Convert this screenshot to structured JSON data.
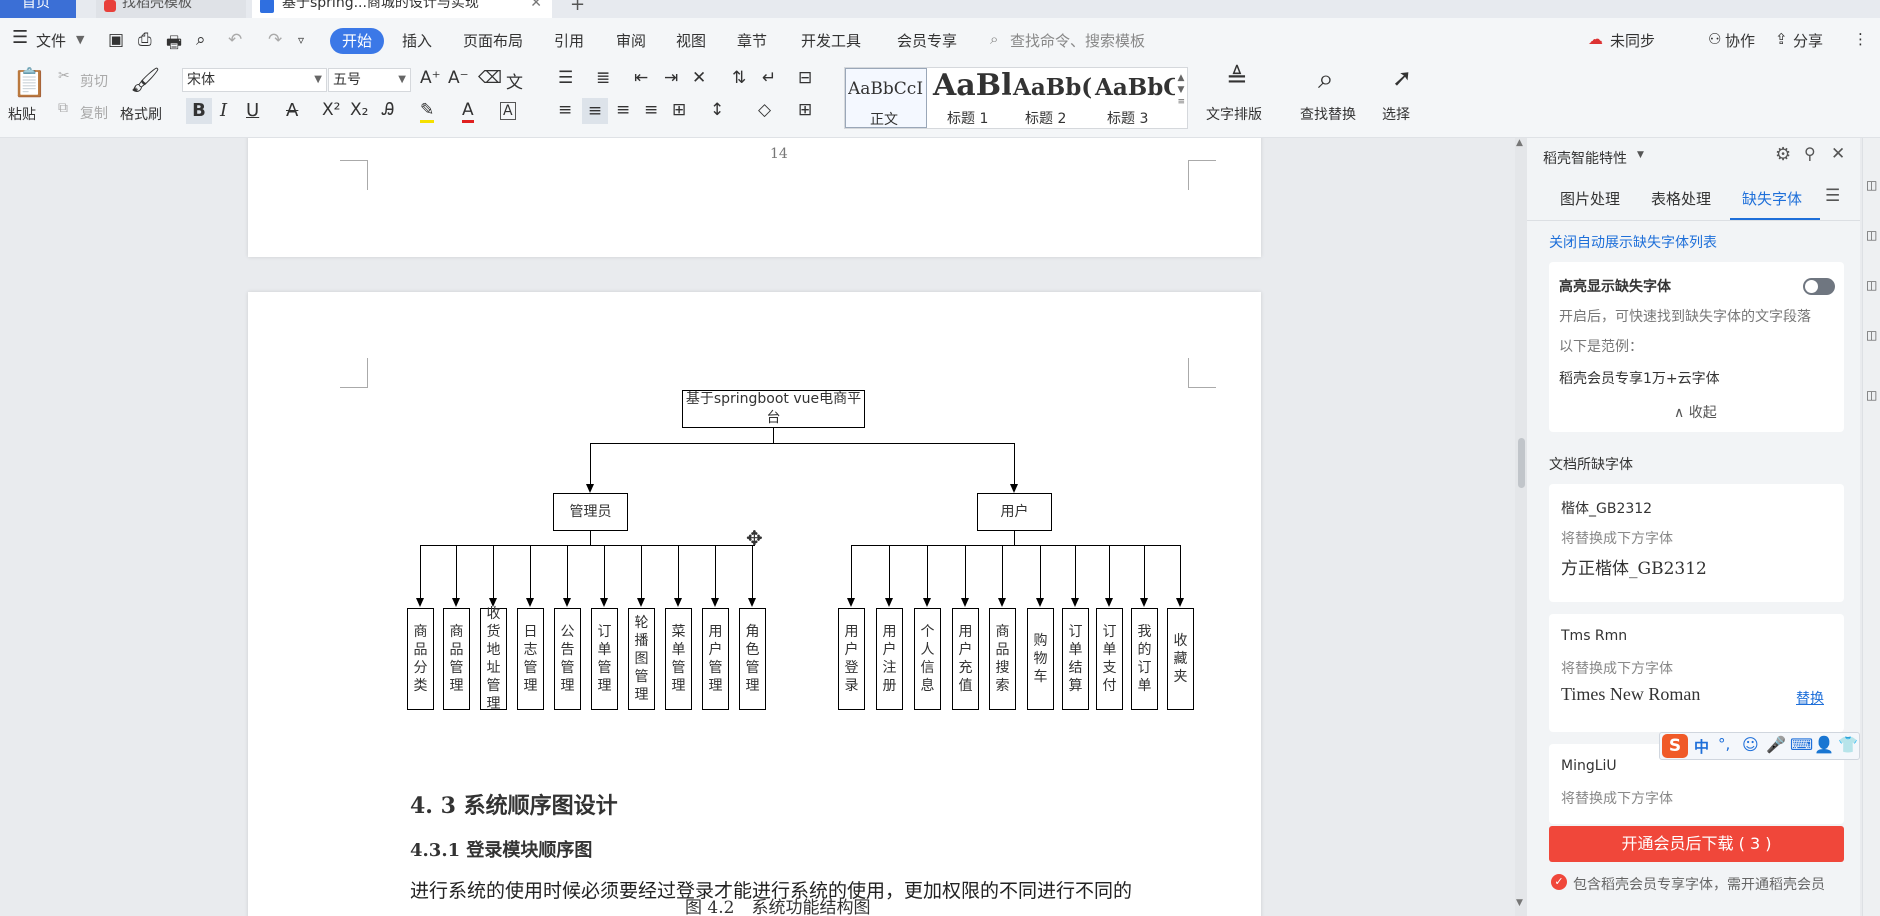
{
  "tabs": [
    {
      "label": "首页"
    },
    {
      "label": "找稻壳模板"
    },
    {
      "label": "基于spring...商城的设计与实现"
    }
  ],
  "menu": {
    "file": "文件",
    "items": [
      "开始",
      "插入",
      "页面布局",
      "引用",
      "审阅",
      "视图",
      "章节",
      "开发工具",
      "会员专享"
    ],
    "search_placeholder": "查找命令、搜索模板",
    "right": {
      "sync": "未同步",
      "collab": "协作",
      "share": "分享"
    }
  },
  "ribbon": {
    "paste": "粘贴",
    "cut": "剪切",
    "copy": "复制",
    "format_painter": "格式刷",
    "font_name": "宋体",
    "font_size": "五号",
    "styles": [
      {
        "preview": "AaBbCcI",
        "name": "正文"
      },
      {
        "preview": "AaBl",
        "name": "标题 1"
      },
      {
        "preview": "AaBb(",
        "name": "标题 2"
      },
      {
        "preview": "AaBbC",
        "name": "标题 3"
      }
    ],
    "text_layout": "文字排版",
    "find_replace": "查找替换",
    "select": "选择"
  },
  "document": {
    "page_number": "14",
    "diagram": {
      "root": "基于springboot vue电商平台",
      "admin": "管理员",
      "user": "用户",
      "admin_children": [
        "商品分类",
        "商品管理",
        "收货地址管理",
        "日志管理",
        "公告管理",
        "订单管理",
        "轮播图管理",
        "菜单管理",
        "用户管理",
        "角色管理"
      ],
      "user_children": [
        "用户登录",
        "用户注册",
        "个人信息",
        "用户充值",
        "商品搜索",
        "购物车",
        "订单结算",
        "订单支付",
        "我的订单",
        "收藏夹"
      ]
    },
    "figure_caption": "图 4.2　系统功能结构图",
    "heading_43": "4. 3  系统顺序图设计",
    "heading_431": "4.3.1  登录模块顺序图",
    "body_text": "进行系统的使用时候必须要经过登录才能进行系统的使用，更加权限的不同进行不同的"
  },
  "panel": {
    "title": "稻壳智能特性",
    "tabs": [
      "图片处理",
      "表格处理",
      "缺失字体"
    ],
    "close_auto": "关闭自动展示缺失字体列表",
    "highlight_title": "高亮显示缺失字体",
    "highlight_desc": "开启后，可快速找到缺失字体的文字段落",
    "example_label": "以下是范例：",
    "example_text": "稻壳会员专享1万+云字体",
    "collapse": "收起",
    "missing_title": "文档所缺字体",
    "fonts": [
      {
        "name": "楷体_GB2312",
        "hint": "将替换成下方字体",
        "replacement": "方正楷体_GB2312"
      },
      {
        "name": "Tms Rmn",
        "hint": "将替换成下方字体",
        "replacement": "Times New Roman",
        "action": "替换"
      },
      {
        "name": "MingLiU",
        "hint": "将替换成下方字体"
      }
    ],
    "download_button": "开通会员后下载 ( 3 )",
    "footer_note": "包含稻壳会员专享字体，需开通稻壳会员"
  },
  "ime": {
    "lang": "中"
  },
  "colors": {
    "accent": "#1e6fd9",
    "primary_tab": "#3b78e7",
    "download": "#f0473a"
  }
}
